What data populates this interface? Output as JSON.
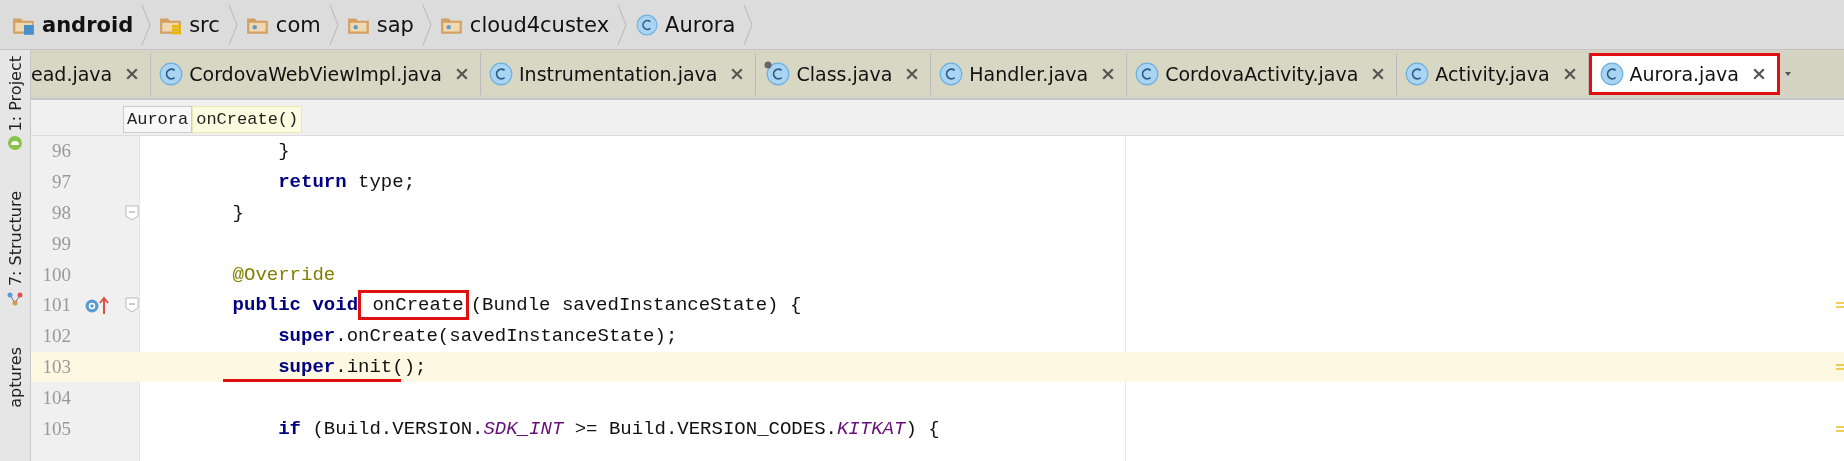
{
  "breadcrumbs": [
    {
      "label": "android",
      "kind": "module"
    },
    {
      "label": "src",
      "kind": "source"
    },
    {
      "label": "com",
      "kind": "package"
    },
    {
      "label": "sap",
      "kind": "package"
    },
    {
      "label": "cloud4custex",
      "kind": "package"
    },
    {
      "label": "Aurora",
      "kind": "class"
    }
  ],
  "tabs": [
    {
      "label": "ead.java",
      "selected": false,
      "icon": false,
      "pinned": false,
      "outlined": false
    },
    {
      "label": "CordovaWebViewImpl.java",
      "selected": false,
      "icon": true,
      "pinned": false,
      "outlined": false
    },
    {
      "label": "Instrumentation.java",
      "selected": false,
      "icon": true,
      "pinned": false,
      "outlined": false
    },
    {
      "label": "Class.java",
      "selected": false,
      "icon": true,
      "pinned": true,
      "outlined": false
    },
    {
      "label": "Handler.java",
      "selected": false,
      "icon": true,
      "pinned": false,
      "outlined": false
    },
    {
      "label": "CordovaActivity.java",
      "selected": false,
      "icon": true,
      "pinned": false,
      "outlined": false
    },
    {
      "label": "Activity.java",
      "selected": false,
      "icon": true,
      "pinned": false,
      "outlined": false
    },
    {
      "label": "Aurora.java",
      "selected": true,
      "icon": true,
      "pinned": false,
      "outlined": true
    }
  ],
  "tool_windows": [
    {
      "label": "1: Project",
      "kind": "project"
    },
    {
      "label": "7: Structure",
      "kind": "structure"
    },
    {
      "label": "aptures",
      "kind": "captures"
    }
  ],
  "method_breadcrumbs": [
    {
      "label": "Aurora",
      "selected": false
    },
    {
      "label": "onCreate()",
      "selected": true
    }
  ],
  "lines": [
    {
      "number": "96",
      "current": false,
      "tokens": [
        {
          "text": "        }",
          "kind": "plain",
          "outlined": false
        }
      ]
    },
    {
      "number": "97",
      "current": false,
      "tokens": [
        {
          "text": "        return",
          "kind": "keyword",
          "outlined": false
        },
        {
          "text": " type;",
          "kind": "plain",
          "outlined": false
        }
      ]
    },
    {
      "number": "98",
      "current": false,
      "gutter_icons": [
        {
          "kind": "fold"
        }
      ],
      "tokens": [
        {
          "text": "    }",
          "kind": "plain",
          "outlined": false
        }
      ]
    },
    {
      "number": "99",
      "current": false
    },
    {
      "number": "100",
      "current": false,
      "tokens": [
        {
          "text": "    @Override",
          "kind": "annotation",
          "outlined": false
        }
      ]
    },
    {
      "number": "101",
      "current": false,
      "gutter_icons": [
        {
          "kind": "override"
        },
        {
          "kind": "fold"
        }
      ],
      "stripe_marks": [
        {
          "kind": "usage"
        }
      ],
      "tokens": [
        {
          "text": "    public",
          "kind": "keyword",
          "outlined": false
        },
        {
          "text": " void",
          "kind": "keyword",
          "outlined": false
        },
        {
          "text": " onCreate",
          "kind": "plain",
          "outlined": true
        },
        {
          "text": "(Bundle savedInstanceState) {",
          "kind": "plain",
          "outlined": false
        }
      ]
    },
    {
      "number": "102",
      "current": false,
      "tokens": [
        {
          "text": "        super",
          "kind": "keyword",
          "outlined": false
        },
        {
          "text": ".onCreate(savedInstanceState);",
          "kind": "plain",
          "outlined": false
        }
      ]
    },
    {
      "number": "103",
      "current": true,
      "annotations": [
        {
          "kind": "underline"
        }
      ],
      "stripe_marks": [
        {
          "kind": "usage"
        }
      ],
      "tokens": [
        {
          "text": "        super",
          "kind": "keyword",
          "outlined": false
        },
        {
          "text": ".init();",
          "kind": "plain",
          "outlined": false
        }
      ]
    },
    {
      "number": "104",
      "current": false
    },
    {
      "number": "105",
      "current": false,
      "stripe_marks": [
        {
          "kind": "usage"
        }
      ],
      "tokens": [
        {
          "text": "        if",
          "kind": "keyword",
          "outlined": false
        },
        {
          "text": " (Build.VERSION.",
          "kind": "plain",
          "outlined": false
        },
        {
          "text": "SDK_INT",
          "kind": "static",
          "outlined": false
        },
        {
          "text": " >= Build.VERSION_CODES.",
          "kind": "plain",
          "outlined": false
        },
        {
          "text": "KITKAT",
          "kind": "static",
          "outlined": false
        },
        {
          "text": ") {",
          "kind": "plain",
          "outlined": false
        }
      ]
    }
  ]
}
